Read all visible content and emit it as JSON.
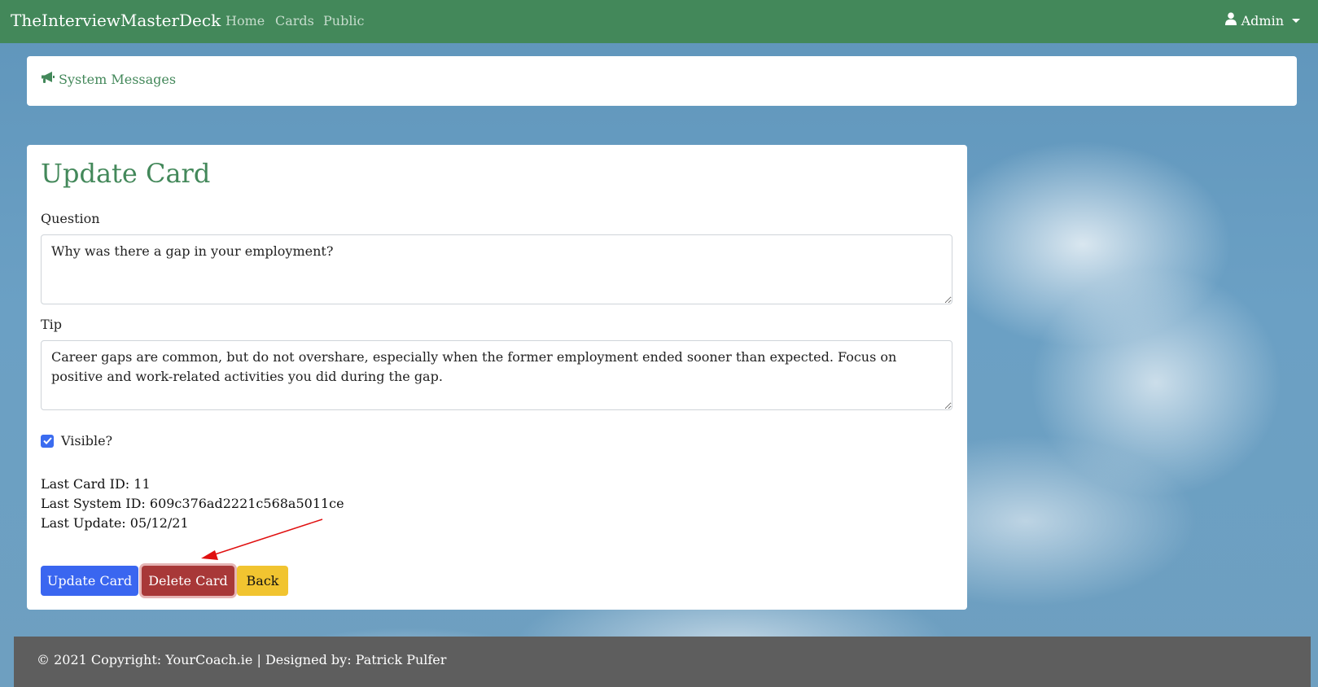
{
  "navbar": {
    "brand": "TheInterviewMasterDeck",
    "links": [
      "Home",
      "Cards",
      "Public"
    ],
    "user_menu": "Admin"
  },
  "system_messages": {
    "label": "System Messages"
  },
  "form": {
    "title": "Update Card",
    "question_label": "Question",
    "question_value": "Why was there a gap in your employment?",
    "tip_label": "Tip",
    "tip_value": "Career gaps are common, but do not overshare, especially when the former employment ended sooner than expected. Focus on positive and work-related activities you did during the gap.",
    "visible_label": "Visible?",
    "visible_checked": true,
    "last_card_id": "Last Card ID: 11",
    "last_system_id": "Last System ID: 609c376ad2221c568a5011ce",
    "last_update": "Last Update: 05/12/21",
    "buttons": {
      "update": "Update Card",
      "delete": "Delete Card",
      "back": "Back"
    }
  },
  "footer": {
    "text": "© 2021 Copyright: YourCoach.ie | Designed by: Patrick Pulfer"
  },
  "colors": {
    "navbar": "#43885a",
    "update_button": "#3a66f0",
    "delete_button": "#a83838",
    "back_button": "#f1c430",
    "footer": "#5e5e5e",
    "annotation_arrow": "#e01010"
  },
  "icons": [
    "bullhorn-icon",
    "user-icon",
    "check-icon",
    "arrow-annotation"
  ]
}
